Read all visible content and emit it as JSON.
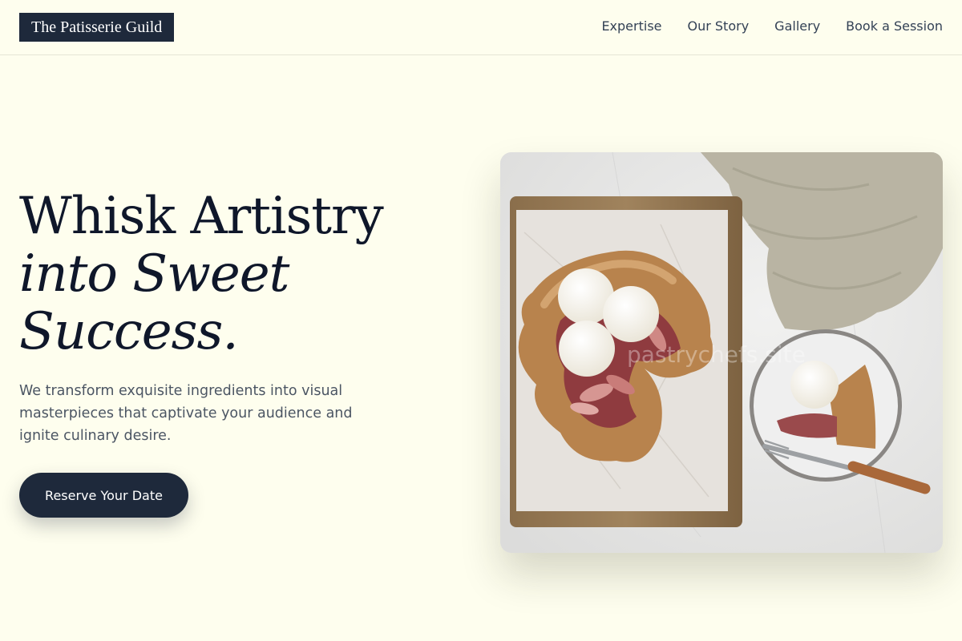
{
  "brand": {
    "name": "The Patisserie Guild"
  },
  "nav": {
    "items": [
      {
        "label": "Expertise"
      },
      {
        "label": "Our Story"
      },
      {
        "label": "Gallery"
      },
      {
        "label": "Book a Session"
      }
    ]
  },
  "hero": {
    "title_line1": "Whisk Artistry",
    "title_line2": "into Sweet",
    "title_line3": "Success.",
    "subtitle": "We transform exquisite ingredients into visual masterpieces that captivate your audience and ignite culinary desire.",
    "cta_label": "Reserve Your Date",
    "image_watermark": "pastrychefs.site"
  },
  "colors": {
    "background": "#fefeee",
    "primary": "#1e293b",
    "text": "#0f172a",
    "muted": "#4b5563"
  },
  "icons": {
    "hero_image": "galette-photo"
  }
}
